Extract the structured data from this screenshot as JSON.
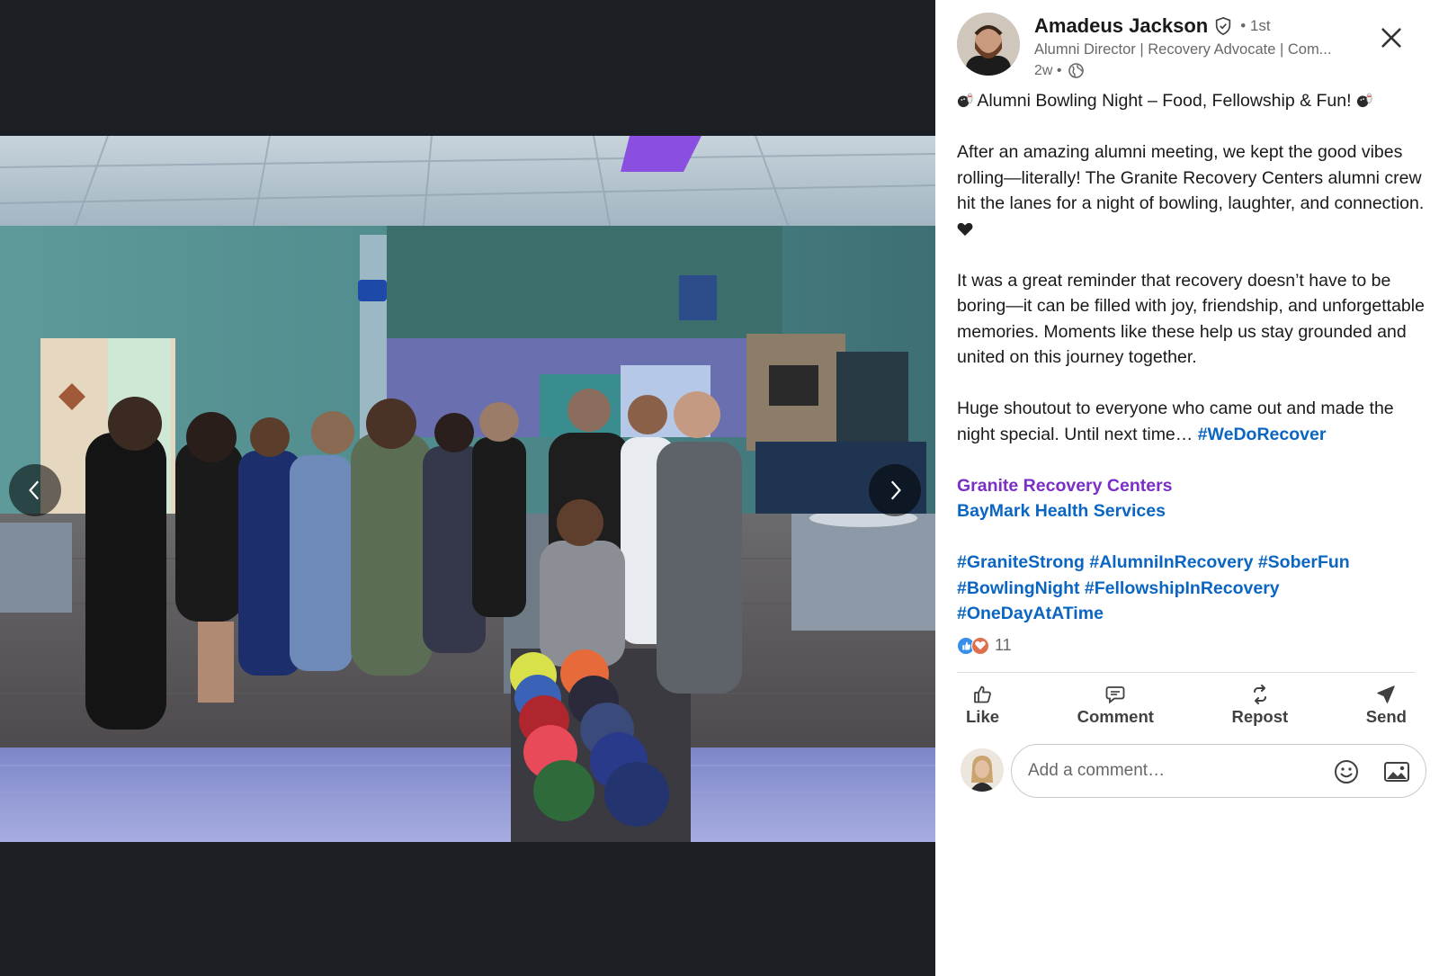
{
  "author": {
    "name": "Amadeus Jackson",
    "degree": "• 1st",
    "headline": "Alumni Director | Recovery Advocate | Com...",
    "time": "2w •"
  },
  "post": {
    "title": "Alumni Bowling Night – Food, Fellowship & Fun!",
    "paragraph1": "After an amazing alumni meeting, we kept the good vibes rolling—literally! The Granite Recovery Centers alumni crew hit the lanes for a night of bowling, laughter, and connection.",
    "paragraph2": "It was a great reminder that recovery doesn’t have to be boring—it can be filled with joy, friendship, and unforgettable memories. Moments like these help us stay grounded and united on this journey together.",
    "paragraph3": "Huge shoutout to everyone who came out and made the night special. Until next time…",
    "inline_hashtag": "#WeDoRecover",
    "mention_1": "Granite Recovery Centers",
    "mention_2": "BayMark Health Services",
    "hashtags_line1": "#GraniteStrong #AlumniInRecovery #SoberFun",
    "hashtags_line2": "#BowlingNight #FellowshipInRecovery",
    "hashtags_line3": "#OneDayAtATime"
  },
  "reactions": {
    "count": "11"
  },
  "actions": {
    "like": "Like",
    "comment": "Comment",
    "repost": "Repost",
    "send": "Send"
  },
  "comment_box": {
    "placeholder": "Add a comment…"
  },
  "colors": {
    "link_blue": "#0a66c2",
    "mention_purple": "#7b2fc6",
    "viewer_bg": "#1b1f23"
  },
  "icons": [
    "verified-icon",
    "globe-icon",
    "close-icon",
    "bowling-icon",
    "black-heart-icon",
    "like-reaction-icon",
    "love-reaction-icon",
    "like-icon",
    "comment-icon",
    "repost-icon",
    "send-icon",
    "emoji-icon",
    "image-icon",
    "chevron-left-icon",
    "chevron-right-icon"
  ]
}
